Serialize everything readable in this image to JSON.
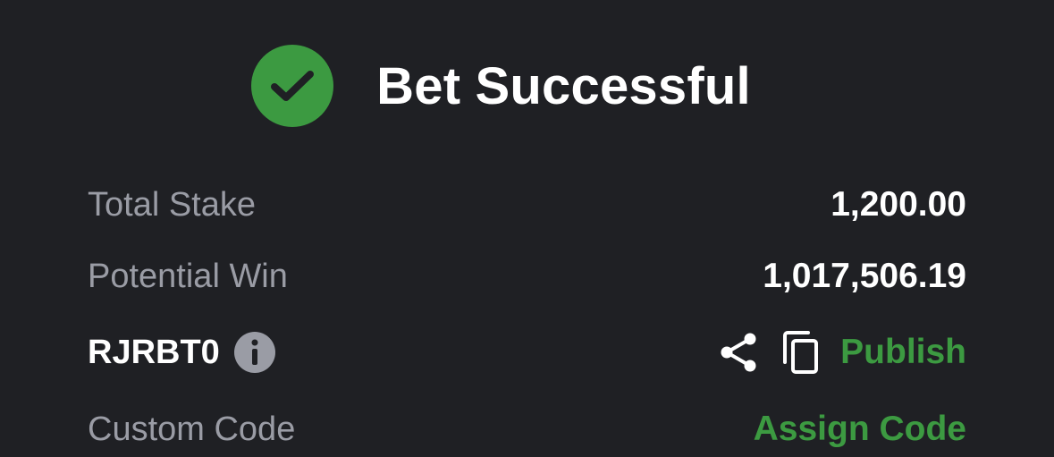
{
  "header": {
    "title": "Bet Successful",
    "icon": "check-circle-icon",
    "icon_color": "#3c9a41"
  },
  "summary": {
    "total_stake_label": "Total Stake",
    "total_stake_value": "1,200.00",
    "potential_win_label": "Potential Win",
    "potential_win_value": "1,017,506.19"
  },
  "booking": {
    "code": "RJRBT0",
    "info_icon": "info-icon",
    "share_icon": "share-icon",
    "copy_icon": "copy-icon",
    "publish_label": "Publish"
  },
  "custom_code": {
    "label": "Custom Code",
    "action_label": "Assign Code"
  },
  "colors": {
    "background": "#1f2024",
    "accent_green": "#3c9a41",
    "muted_text": "#9a9ca5",
    "primary_text": "#ffffff"
  }
}
